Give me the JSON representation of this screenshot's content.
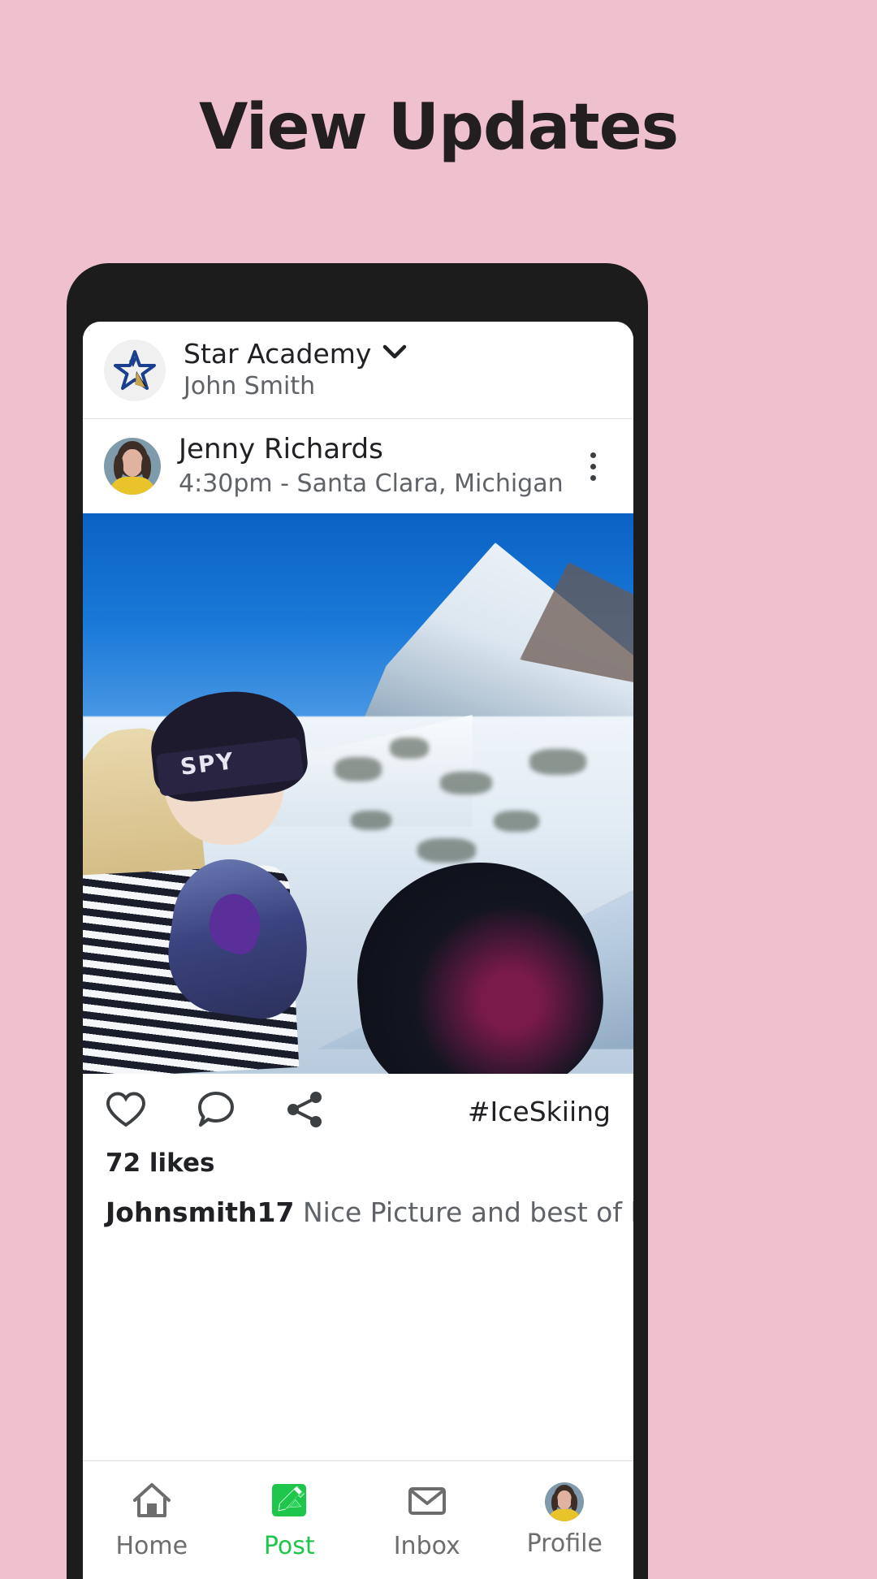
{
  "page": {
    "title": "View Updates",
    "background_color": "#efc0ce"
  },
  "appbar": {
    "brand_name": "Star Academy",
    "user_name": "John Smith",
    "logo_icon": "star-logo-icon",
    "chevron_icon": "chevron-down-icon"
  },
  "post": {
    "author": "Jenny Richards",
    "meta": "4:30pm - Santa Clara, Michigan",
    "avatar_icon": "user-avatar",
    "menu_icon": "kebab-menu-icon",
    "photo_alt": "skier-mountain-photo",
    "actions": {
      "like_icon": "heart-icon",
      "comment_icon": "comment-bubble-icon",
      "share_icon": "share-icon",
      "hashtag": "#IceSkiing"
    },
    "likes": "72 likes",
    "comment_author": "Johnsmith17",
    "comment_text": "Nice Picture and best of luck for your"
  },
  "bottom_nav": {
    "active_color": "#1ec64b",
    "inactive_color": "#6d6d6d",
    "items": [
      {
        "label": "Home",
        "icon": "home-icon",
        "active": false
      },
      {
        "label": "Post",
        "icon": "post-edit-icon",
        "active": true
      },
      {
        "label": "Inbox",
        "icon": "envelope-icon",
        "active": false
      },
      {
        "label": "Profile",
        "icon": "profile-avatar-icon",
        "active": false
      }
    ]
  }
}
